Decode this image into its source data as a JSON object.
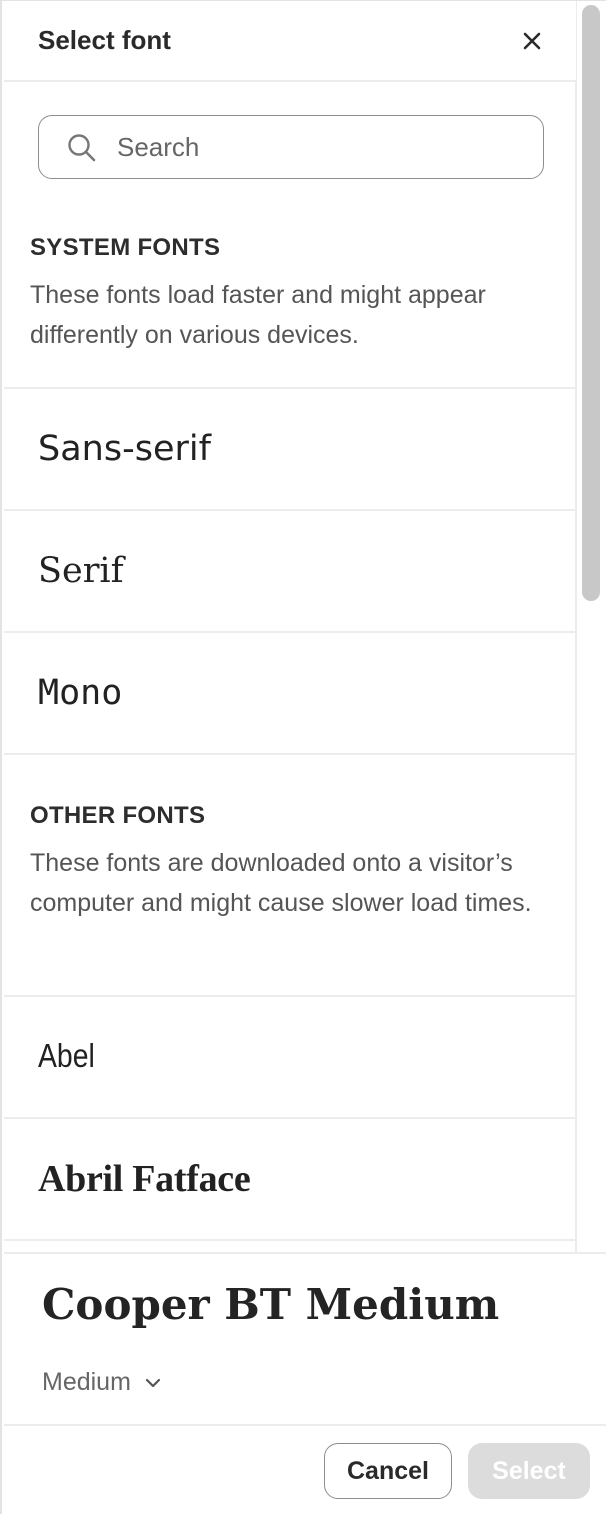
{
  "dialog": {
    "title": "Select font",
    "close_icon": "close-icon"
  },
  "search": {
    "placeholder": "Search",
    "value": ""
  },
  "system_fonts": {
    "heading": "SYSTEM FONTS",
    "description": "These fonts load faster and might appear differently on various devices.",
    "items": [
      {
        "label": "Sans-serif"
      },
      {
        "label": "Serif"
      },
      {
        "label": "Mono"
      }
    ]
  },
  "other_fonts": {
    "heading": "OTHER FONTS",
    "description": "These fonts are downloaded onto a visitor’s computer and might cause slower load times.",
    "items": [
      {
        "label": "Abel"
      },
      {
        "label": "Abril Fatface"
      }
    ]
  },
  "preview": {
    "font_name": "Cooper BT Medium",
    "weight": "Medium"
  },
  "footer": {
    "cancel_label": "Cancel",
    "select_label": "Select"
  },
  "colors": {
    "border": "#ececec",
    "disabled_button": "#dcdcdc",
    "scrollbar": "#c8c8c8"
  }
}
